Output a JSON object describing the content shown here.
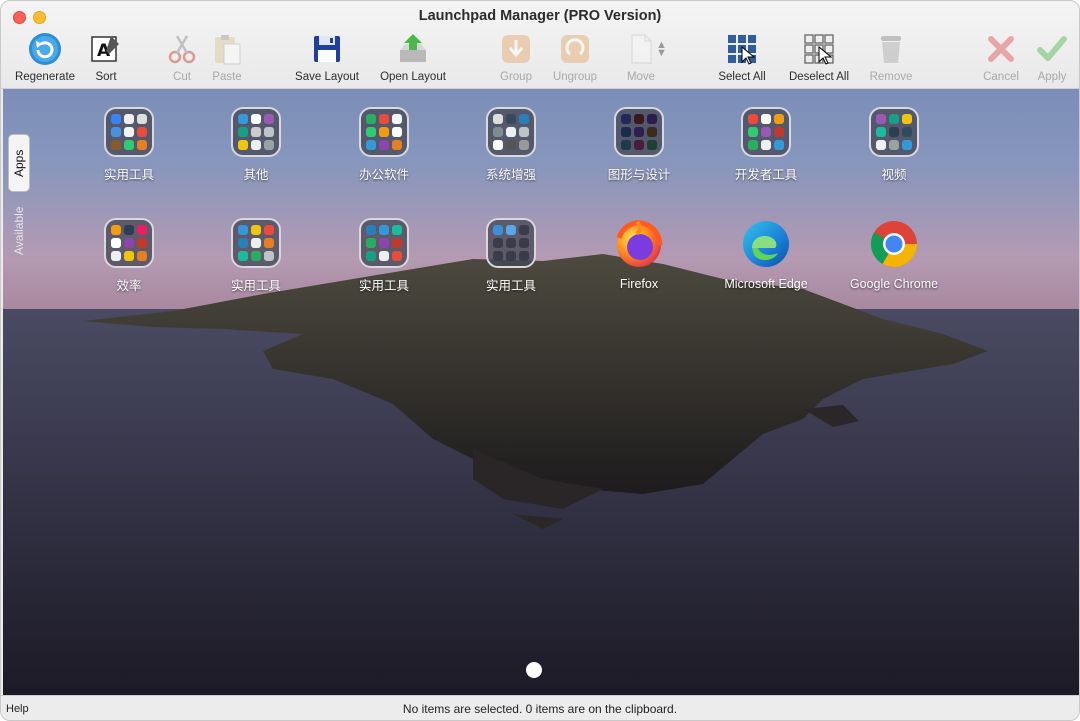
{
  "window": {
    "title": "Launchpad Manager (PRO Version)"
  },
  "toolbar": {
    "regenerate": "Regenerate",
    "sort": "Sort",
    "cut": "Cut",
    "paste": "Paste",
    "save_layout": "Save Layout",
    "open_layout": "Open Layout",
    "group": "Group",
    "ungroup": "Ungroup",
    "move": "Move",
    "select_all": "Select All",
    "deselect_all": "Deselect All",
    "remove": "Remove",
    "cancel": "Cancel",
    "apply": "Apply"
  },
  "side_tabs": {
    "apps": "Apps",
    "available": "Available"
  },
  "grid": {
    "row1": [
      {
        "name": "实用工具",
        "type": "folder"
      },
      {
        "name": "其他",
        "type": "folder"
      },
      {
        "name": "办公软件",
        "type": "folder"
      },
      {
        "name": "系统增强",
        "type": "folder"
      },
      {
        "name": "图形与设计",
        "type": "folder"
      },
      {
        "name": "开发者工具",
        "type": "folder"
      },
      {
        "name": "视频",
        "type": "folder"
      }
    ],
    "row2": [
      {
        "name": "效率",
        "type": "folder"
      },
      {
        "name": "实用工具",
        "type": "folder"
      },
      {
        "name": "实用工具",
        "type": "folder"
      },
      {
        "name": "实用工具",
        "type": "folder"
      },
      {
        "name": "Firefox",
        "type": "app",
        "icon": "firefox-icon"
      },
      {
        "name": "Microsoft Edge",
        "type": "app",
        "icon": "edge-icon"
      },
      {
        "name": "Google Chrome",
        "type": "app",
        "icon": "chrome-icon"
      }
    ]
  },
  "status": {
    "help": "Help",
    "message": "No items are selected. 0 items are on the clipboard."
  },
  "colors": {
    "close": "#fe5f57",
    "minimize": "#febc2e",
    "regenerate_blue": "#2b8fd6",
    "cancel_red": "#e05050",
    "apply_green": "#4cb84c"
  }
}
